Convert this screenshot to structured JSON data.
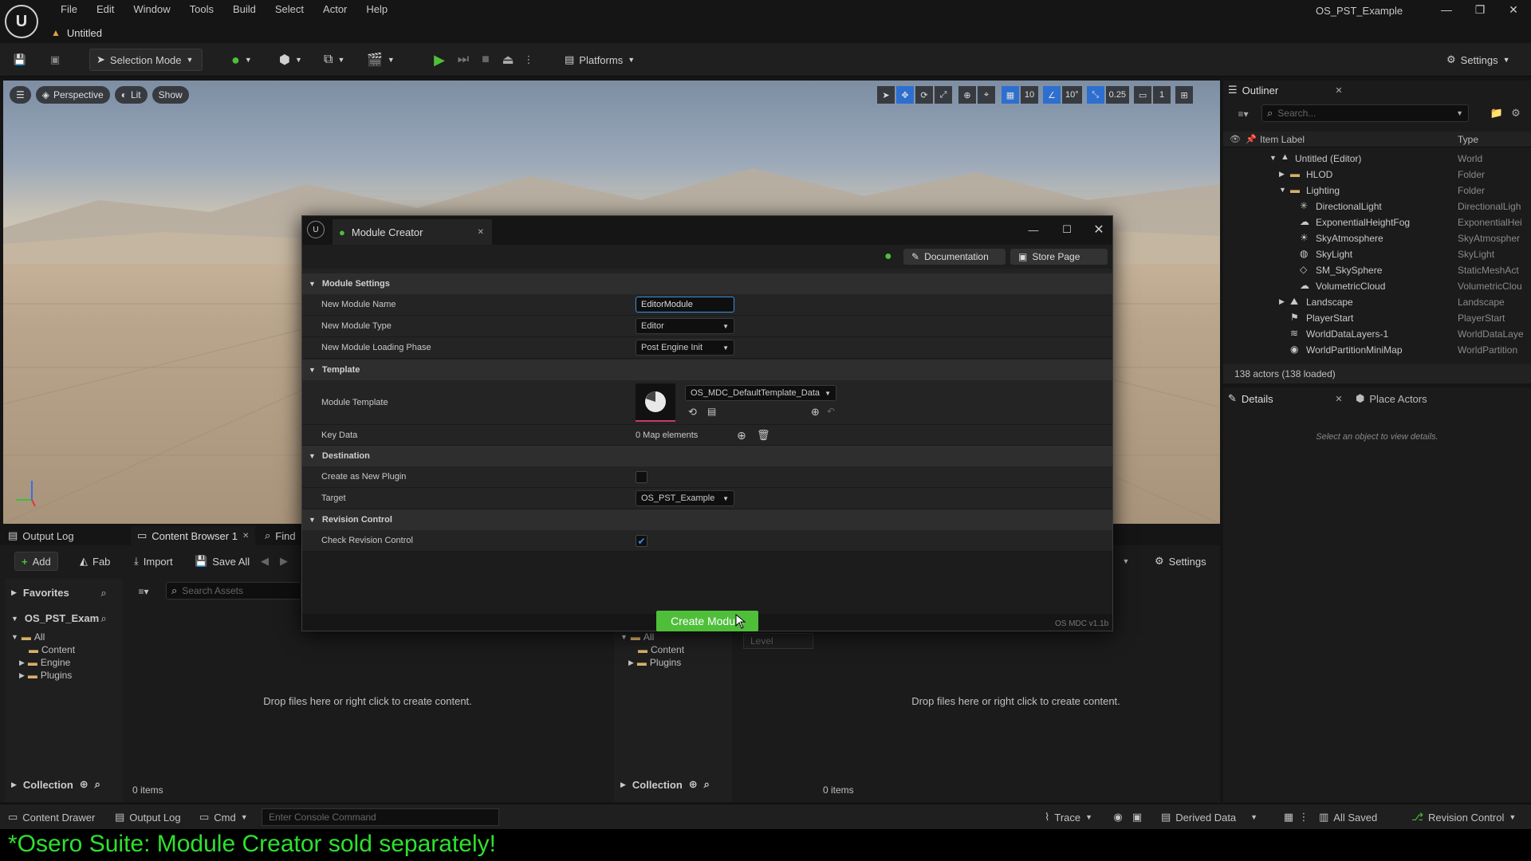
{
  "app": {
    "menu": [
      "File",
      "Edit",
      "Window",
      "Tools",
      "Build",
      "Select",
      "Actor",
      "Help"
    ],
    "level_tab": "Untitled",
    "project_name": "OS_PST_Example"
  },
  "toolbar": {
    "selection_mode": "Selection Mode",
    "platforms": "Platforms",
    "settings": "Settings"
  },
  "viewport": {
    "perspective": "Perspective",
    "lit": "Lit",
    "show": "Show",
    "grid_snap": "10",
    "rot_snap": "10°",
    "scale_snap": "0.25",
    "camera_speed": "1"
  },
  "outliner": {
    "tab": "Outliner",
    "search_placeholder": "Search...",
    "col_label": "Item Label",
    "col_type": "Type",
    "items": [
      {
        "label": "Untitled (Editor)",
        "type": "World"
      },
      {
        "label": "HLOD",
        "type": "Folder"
      },
      {
        "label": "Lighting",
        "type": "Folder"
      },
      {
        "label": "DirectionalLight",
        "type": "DirectionalLigh"
      },
      {
        "label": "ExponentialHeightFog",
        "type": "ExponentialHei"
      },
      {
        "label": "SkyAtmosphere",
        "type": "SkyAtmospher"
      },
      {
        "label": "SkyLight",
        "type": "SkyLight"
      },
      {
        "label": "SM_SkySphere",
        "type": "StaticMeshAct"
      },
      {
        "label": "VolumetricCloud",
        "type": "VolumetricClou"
      },
      {
        "label": "Landscape",
        "type": "Landscape"
      },
      {
        "label": "PlayerStart",
        "type": "PlayerStart"
      },
      {
        "label": "WorldDataLayers-1",
        "type": "WorldDataLaye"
      },
      {
        "label": "WorldPartitionMiniMap",
        "type": "WorldPartition"
      }
    ],
    "footer": "138 actors (138 loaded)"
  },
  "details": {
    "tab_details": "Details",
    "tab_place": "Place Actors",
    "empty": "Select an object to view details."
  },
  "bottom": {
    "tab_output": "Output Log",
    "tab_content": "Content Browser 1",
    "tab_find": "Find",
    "add": "Add",
    "fab": "Fab",
    "import": "Import",
    "save_all": "Save All",
    "settings": "Settings",
    "favorites": "Favorites",
    "project": "OS_PST_Exam",
    "search_assets": "Search Assets",
    "tree": [
      "All",
      "Content",
      "Engine",
      "Plugins"
    ],
    "tree2": [
      "All",
      "Content",
      "Plugins"
    ],
    "drop_hint": "Drop files here or right click to create content.",
    "collection": "Collection",
    "items_count": "0 items",
    "level_filter": "Level"
  },
  "status": {
    "content_drawer": "Content Drawer",
    "output_log": "Output Log",
    "cmd": "Cmd",
    "console_placeholder": "Enter Console Command",
    "trace": "Trace",
    "derived_data": "Derived Data",
    "all_saved": "All Saved",
    "revision_control": "Revision Control"
  },
  "dialog": {
    "tab": "Module Creator",
    "documentation": "Documentation",
    "store_page": "Store Page",
    "sections": {
      "module_settings": "Module Settings",
      "template": "Template",
      "destination": "Destination",
      "revision": "Revision Control"
    },
    "fields": {
      "name_label": "New Module Name",
      "name_value": "EditorModule",
      "type_label": "New Module Type",
      "type_value": "Editor",
      "phase_label": "New Module Loading Phase",
      "phase_value": "Post Engine Init",
      "template_label": "Module Template",
      "template_value": "OS_MDC_DefaultTemplate_Data",
      "keydata_label": "Key Data",
      "keydata_value": "0 Map elements",
      "plugin_label": "Create as New Plugin",
      "plugin_checked": false,
      "target_label": "Target",
      "target_value": "OS_PST_Example",
      "revision_label": "Check Revision Control",
      "revision_checked": true
    },
    "create_button": "Create Module",
    "version": "OS MDC v1.1b"
  },
  "banner": "*Osero Suite: Module Creator sold separately!",
  "colors": {
    "accent_green": "#4fbf3a",
    "banner_green": "#2ee12e",
    "select_blue": "#3a8ee6"
  }
}
